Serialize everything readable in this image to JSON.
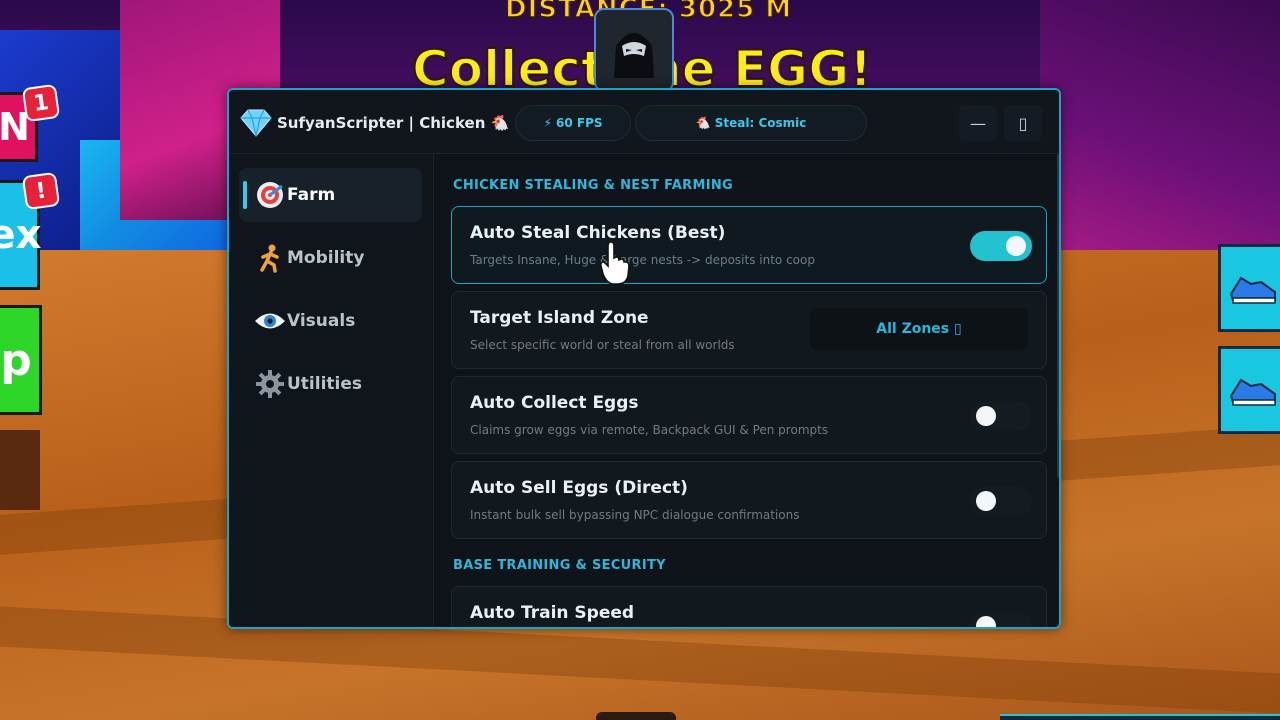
{
  "hud": {
    "distance": "DISTANCE: 3025 M",
    "collect_text": "Collect the EGG!"
  },
  "left_buttons": {
    "btn1_text": "N",
    "btn1_badge": "1",
    "btn2_text": "ex",
    "btn2_badge": "!",
    "btn3_text": "p"
  },
  "panel": {
    "title": "SufyanScripter | Chicken 🐔",
    "fps": "⚡ 60 FPS",
    "steal_status": "🐔 Steal: Cosmic",
    "minimize": "—",
    "maximize": "▯"
  },
  "sidebar": {
    "items": [
      {
        "label": "Farm",
        "icon": "target-icon",
        "active": true
      },
      {
        "label": "Mobility",
        "icon": "runner-icon",
        "active": false
      },
      {
        "label": "Visuals",
        "icon": "eye-icon",
        "active": false
      },
      {
        "label": "Utilities",
        "icon": "gear-icon",
        "active": false
      }
    ]
  },
  "sections": [
    {
      "title": "CHICKEN STEALING & NEST FARMING",
      "rows": [
        {
          "title": "Auto Steal Chickens (Best)",
          "subtitle": "Targets Insane, Huge & Large nests -> deposits into coop",
          "control": "toggle",
          "on": true
        },
        {
          "title": "Target Island Zone",
          "subtitle": "Select specific world or steal from all worlds",
          "control": "dropdown",
          "value": "All Zones ▯"
        },
        {
          "title": "Auto Collect Eggs",
          "subtitle": "Claims grow eggs via remote, Backpack GUI & Pen prompts",
          "control": "toggle",
          "on": false
        },
        {
          "title": "Auto Sell Eggs (Direct)",
          "subtitle": "Instant bulk sell bypassing NPC dialogue confirmations",
          "control": "toggle",
          "on": false
        }
      ]
    },
    {
      "title": "BASE TRAINING & SECURITY",
      "rows": [
        {
          "title": "Auto Train Speed",
          "subtitle": "",
          "control": "toggle",
          "on": false
        }
      ]
    }
  ],
  "colors": {
    "accent": "#1aa3c4",
    "toggle_on": "#22c3cf",
    "panel_bg": "#0e1419"
  }
}
